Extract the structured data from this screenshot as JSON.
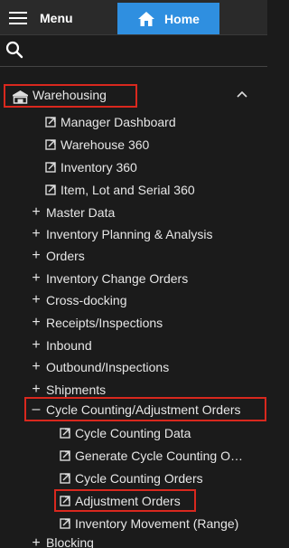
{
  "topbar": {
    "menu_label": "Menu",
    "home_label": "Home",
    "home_color": "#2f8fe0"
  },
  "search": {
    "placeholder": ""
  },
  "section": {
    "label": "Warehousing",
    "icon": "warehouse-icon",
    "expanded": true
  },
  "links": [
    "Manager Dashboard",
    "Warehouse 360",
    "Inventory 360",
    "Item, Lot and Serial 360"
  ],
  "groups": [
    "Master Data",
    "Inventory Planning & Analysis",
    "Orders",
    "Inventory Change Orders",
    "Cross-docking",
    "Receipts/Inspections",
    "Inbound",
    "Outbound/Inspections",
    "Shipments"
  ],
  "expanded_group": {
    "label": "Cycle Counting/Adjustment Orders",
    "items": [
      "Cycle Counting Data",
      "Generate Cycle Counting O…",
      "Cycle Counting Orders",
      "Adjustment Orders",
      "Inventory Movement (Range)"
    ]
  },
  "last_group": "Blocking",
  "highlight_color": "#d9281e"
}
